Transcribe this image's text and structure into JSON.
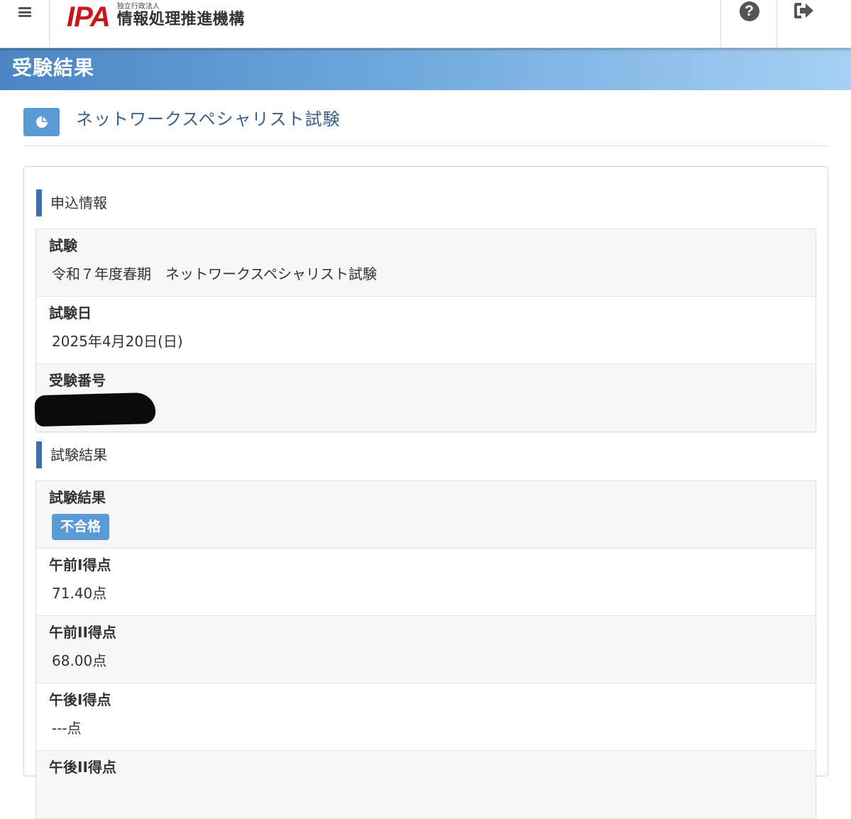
{
  "header": {
    "menu_icon": "hamburger-menu-icon",
    "logo_mark": "IPA",
    "logo_subtitle": "独立行政法人",
    "logo_name": "情報処理推進機構",
    "help_icon": "question-circle-icon",
    "help_glyph": "?",
    "logout_icon": "sign-out-icon"
  },
  "page": {
    "title": "受験結果"
  },
  "exam": {
    "icon": "pie-chart-icon",
    "name": "ネットワークスペシャリスト試験"
  },
  "application_info": {
    "heading": "申込情報",
    "rows": [
      {
        "label": "試験",
        "value": "令和７年度春期　ネットワークスペシャリスト試験"
      },
      {
        "label": "試験日",
        "value": "2025年4月20日(日)"
      },
      {
        "label": "受験番号",
        "value": ""
      }
    ]
  },
  "exam_result": {
    "heading": "試験結果",
    "result_label": "試験結果",
    "result_badge": "不合格",
    "rows": [
      {
        "label": "午前I得点",
        "value": "71.40点"
      },
      {
        "label": "午前II得点",
        "value": "68.00点"
      },
      {
        "label": "午後I得点",
        "value": "---点"
      },
      {
        "label": "午後II得点",
        "value": ""
      }
    ]
  },
  "colors": {
    "brand_red": "#c8161d",
    "accent_blue": "#5b9bd5",
    "section_bar": "#3f6eb0",
    "title_band_start": "#4a86c3",
    "title_band_end": "#a6d0f4"
  }
}
